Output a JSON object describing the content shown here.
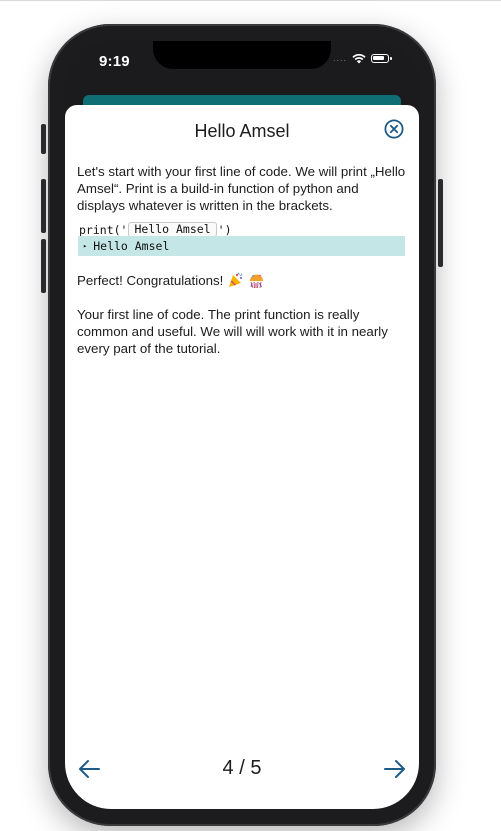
{
  "status_bar": {
    "time": "9:19",
    "signal_dots": "....",
    "icons": [
      "wifi-icon",
      "battery-icon"
    ]
  },
  "lesson": {
    "title": "Hello Amsel",
    "intro": "Let's start with your first line of code. We will print „Hello Amsel“. Print is a build-in function of python and displays whatever is written in the brackets.",
    "code": {
      "prefix": "print('",
      "token": "Hello Amsel",
      "suffix": "')"
    },
    "output": {
      "marker": "▸",
      "text": "Hello Amsel"
    },
    "praise": "Perfect! Congratulations!",
    "praise_emojis": [
      "party-popper-icon",
      "confetti-ball-icon"
    ],
    "explanation": "Your first line of code. The print function is really common and useful. We will will work with it in nearly every part of the tutorial."
  },
  "navigation": {
    "page_indicator": "4 / 5",
    "prev_icon": "arrow-left-icon",
    "next_icon": "arrow-right-icon"
  },
  "colors": {
    "accent": "#1d5a86",
    "teal_bar": "#0e6e73",
    "output_bg": "#c5e6e6"
  }
}
